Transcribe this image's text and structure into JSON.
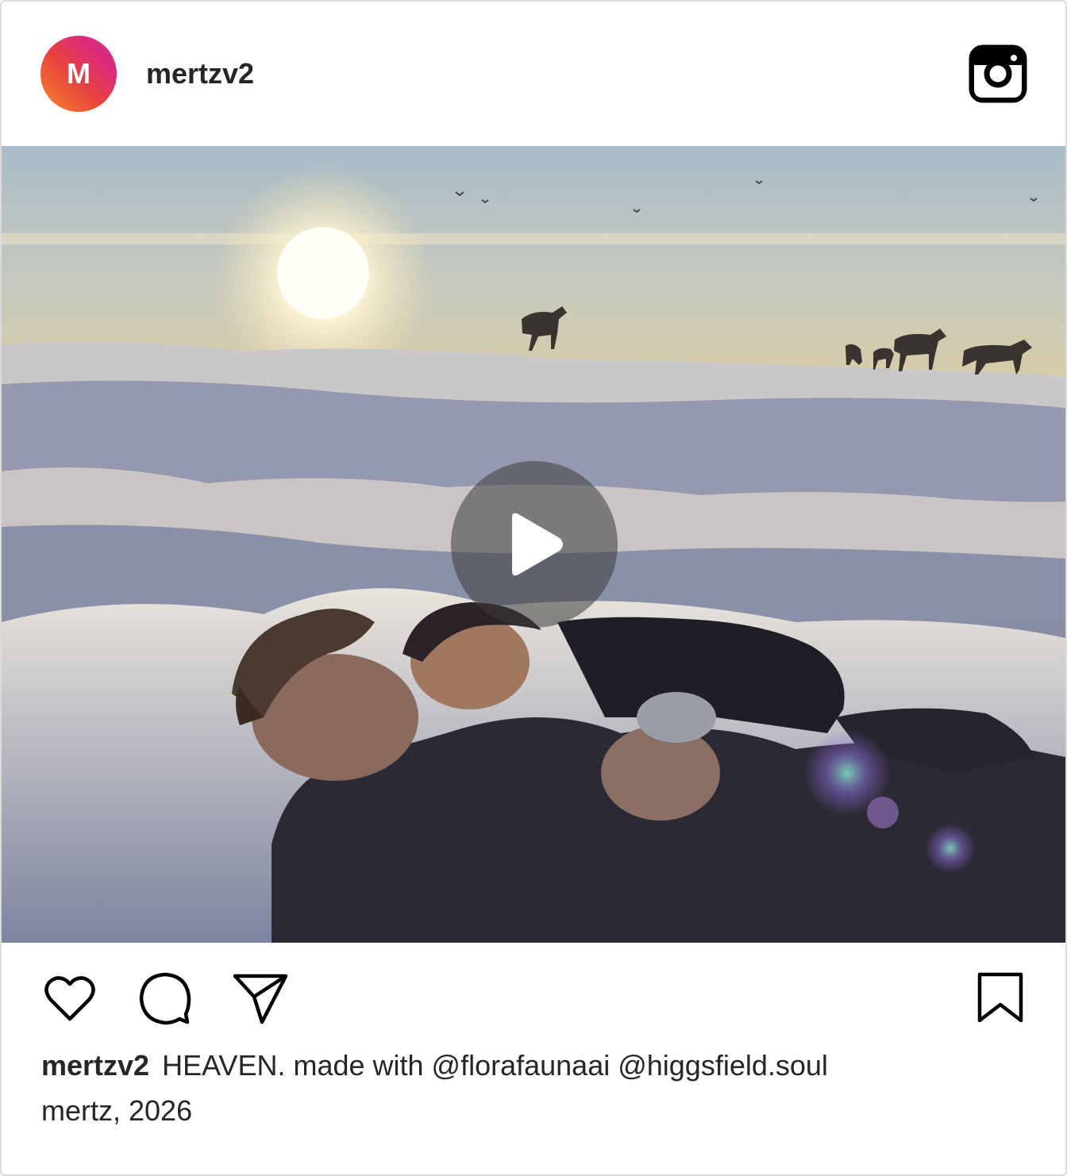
{
  "post": {
    "avatar_initial": "M",
    "username": "mertzv2",
    "media": {
      "type": "video",
      "play_icon": "play-icon"
    },
    "actions": {
      "like_icon": "heart-icon",
      "comment_icon": "comment-icon",
      "share_icon": "send-icon",
      "save_icon": "bookmark-icon"
    },
    "caption": {
      "username": "mertzv2",
      "text": "HEAVEN. made with @florafaunaai @higgsfield.soul",
      "line2": "mertz, 2026"
    }
  },
  "colors": {
    "text": "#262626",
    "border": "#dbdbdb"
  }
}
